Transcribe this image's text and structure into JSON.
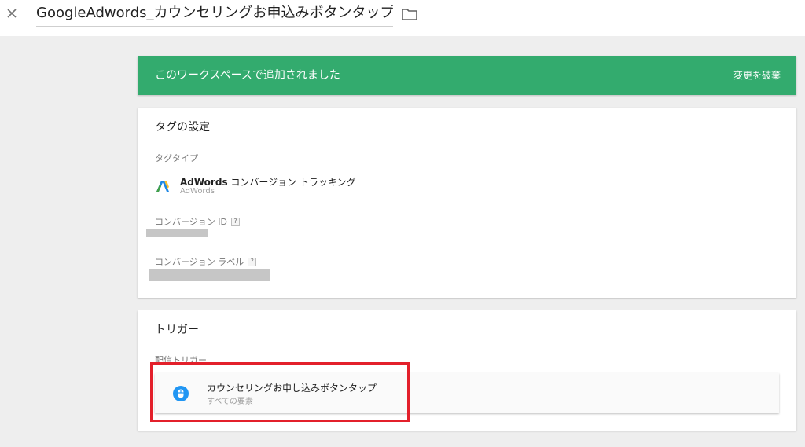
{
  "header": {
    "title": "GoogleAdwords_カウンセリングお申込みボタンタップ",
    "close_icon": "close-icon",
    "folder_icon": "folder-icon"
  },
  "banner": {
    "message": "このワークスペースで追加されました",
    "discard_label": "変更を破棄",
    "color": "#33ab6e"
  },
  "tag_config": {
    "title": "タグの設定",
    "tag_type_label": "タグタイプ",
    "tag_type_name": "AdWords",
    "tag_type_name_suffix": " コンバージョン トラッキング",
    "tag_type_sub": "AdWords",
    "conversion_id_label": "コンバージョン ID",
    "conversion_label_label": "コンバージョン ラベル",
    "help_mark": "?"
  },
  "trigger": {
    "title": "トリガー",
    "firing_label": "配信トリガー",
    "item_name": "カウンセリングお申し込みボタンタップ",
    "item_sub": "すべての要素",
    "icon_color": "#2196f3",
    "highlight_color": "#e3202b"
  }
}
